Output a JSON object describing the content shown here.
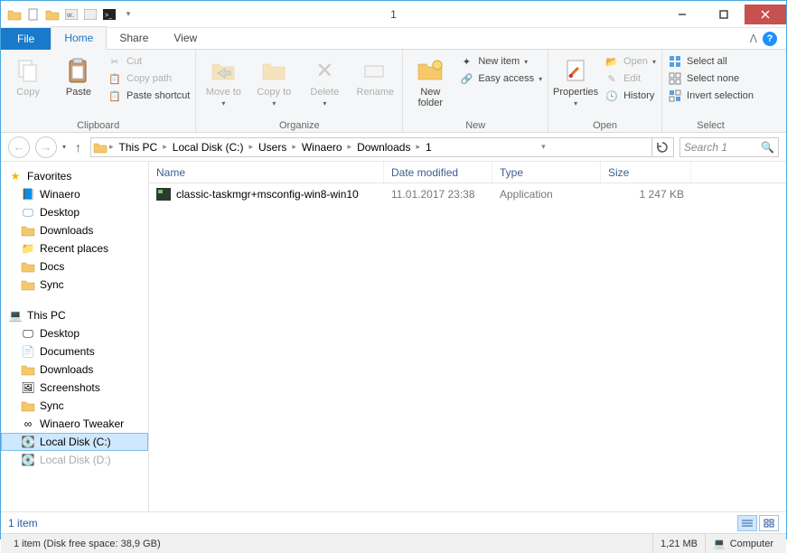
{
  "window": {
    "title": "1"
  },
  "tabs": {
    "file": "File",
    "home": "Home",
    "share": "Share",
    "view": "View"
  },
  "ribbon": {
    "clipboard": {
      "label": "Clipboard",
      "copy": "Copy",
      "paste": "Paste",
      "cut": "Cut",
      "copypath": "Copy path",
      "pasteshortcut": "Paste shortcut"
    },
    "organize": {
      "label": "Organize",
      "moveto": "Move to",
      "copyto": "Copy to",
      "delete": "Delete",
      "rename": "Rename"
    },
    "new": {
      "label": "New",
      "newfolder": "New folder",
      "newitem": "New item",
      "easyaccess": "Easy access"
    },
    "open": {
      "label": "Open",
      "properties": "Properties",
      "open": "Open",
      "edit": "Edit",
      "history": "History"
    },
    "select": {
      "label": "Select",
      "selectall": "Select all",
      "selectnone": "Select none",
      "invert": "Invert selection"
    }
  },
  "breadcrumb": {
    "items": [
      "This PC",
      "Local Disk (C:)",
      "Users",
      "Winaero",
      "Downloads",
      "1"
    ]
  },
  "search": {
    "placeholder": "Search 1"
  },
  "sidebar": {
    "favorites": {
      "label": "Favorites",
      "items": [
        "Winaero",
        "Desktop",
        "Downloads",
        "Recent places",
        "Docs",
        "Sync"
      ]
    },
    "thispc": {
      "label": "This PC",
      "items": [
        "Desktop",
        "Documents",
        "Downloads",
        "Screenshots",
        "Sync",
        "Winaero Tweaker",
        "Local Disk (C:)",
        "Local Disk (D:)"
      ]
    }
  },
  "columns": {
    "name": "Name",
    "date": "Date modified",
    "type": "Type",
    "size": "Size"
  },
  "files": [
    {
      "name": "classic-taskmgr+msconfig-win8-win10",
      "date": "11.01.2017 23:38",
      "type": "Application",
      "size": "1 247 KB"
    }
  ],
  "footer": {
    "count": "1 item",
    "status": "1 item (Disk free space: 38,9 GB)",
    "selsize": "1,21 MB",
    "location": "Computer"
  }
}
